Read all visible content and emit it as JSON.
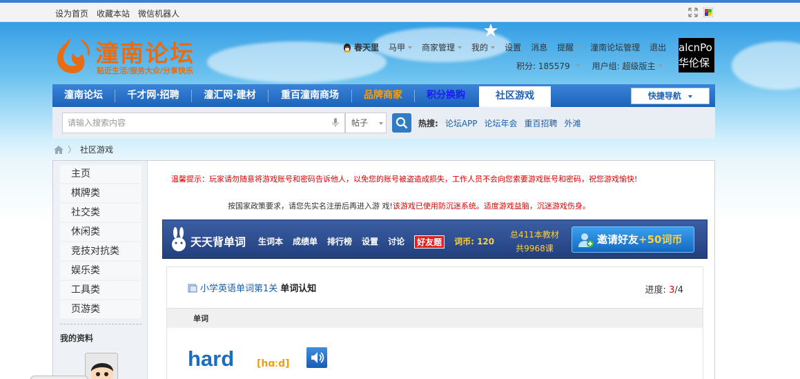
{
  "topbar": {
    "links": [
      "设为首页",
      "收藏本站",
      "微信机器人"
    ],
    "icons": [
      "fullscreen-icon",
      "color-palette-icon"
    ]
  },
  "logo": {
    "name": "潼南论坛",
    "slogan": "贴近生活/服务大众/分享快乐"
  },
  "user": {
    "username": "春天里",
    "menu": [
      {
        "label": "马甲",
        "dropdown": true
      },
      {
        "label": "商家管理",
        "dropdown": true
      },
      {
        "label": "我的",
        "dropdown": true
      },
      {
        "label": "设置",
        "dropdown": false
      },
      {
        "label": "消息",
        "dropdown": false
      },
      {
        "label": "提醒",
        "dropdown": true
      },
      {
        "label": "潼南论坛管理",
        "dropdown": false
      },
      {
        "label": "退出",
        "dropdown": false
      }
    ],
    "points_label": "积分: 185579",
    "group_label": "用户组: 超级版主",
    "avatar_text_1": "alcnPo",
    "avatar_text_2": "华伦保"
  },
  "nav": {
    "items": [
      {
        "label": "潼南论坛",
        "color": "#ffffff"
      },
      {
        "label": "千才网·招聘",
        "color": "#ffffff"
      },
      {
        "label": "潼汇网·建材",
        "color": "#ffffff"
      },
      {
        "label": "重百潼南商场",
        "color": "#ffffff"
      },
      {
        "label": "品牌商家",
        "color": "#ff9c00"
      },
      {
        "label": "积分换购",
        "color": "#1a1aff"
      },
      {
        "label": "社区游戏",
        "color": "#1a63b8"
      }
    ],
    "quick_nav": "快捷导航"
  },
  "search": {
    "placeholder": "请输入搜索内容",
    "type": "帖子",
    "hot_label": "热搜:",
    "hot": [
      "论坛APP",
      "论坛年会",
      "重百招聘",
      "外滩"
    ]
  },
  "breadcrumb": {
    "current": "社区游戏"
  },
  "sidebar": {
    "items": [
      "主页",
      "棋牌类",
      "社交类",
      "休闲类",
      "竞技对抗类",
      "娱乐类",
      "工具类",
      "页游类"
    ],
    "section": "我的资料"
  },
  "notice": {
    "warning": "温馨提示：玩家请勿随意将游戏账号和密码告诉他人，以免您的账号被盗造成损失，工作人员不会向您索要游戏账号和密码，祝您游戏愉快!",
    "policy_prefix": "按国家政策要求，请您先实名注册后再进入游 戏!",
    "policy_red": "该游戏已使用防沉迷系统。适度游戏益脑，沉迷游戏伤身。"
  },
  "game": {
    "title": "天天背单词",
    "nav": [
      "生词本",
      "成绩单",
      "排行榜",
      "设置",
      "讨论"
    ],
    "friends": "好友题",
    "coins": "词币: 120",
    "stats_1": "总411本教材",
    "stats_2": "共9968课",
    "invite_text": "邀请好友",
    "invite_bonus": "+50词币"
  },
  "card": {
    "course": "小学英语单词第1关",
    "mode": "单词认知",
    "progress_label": "进度:",
    "progress_current": "3",
    "progress_total": "/4",
    "column": "单词",
    "word": "hard",
    "phonetic": "[hɑːd]"
  }
}
